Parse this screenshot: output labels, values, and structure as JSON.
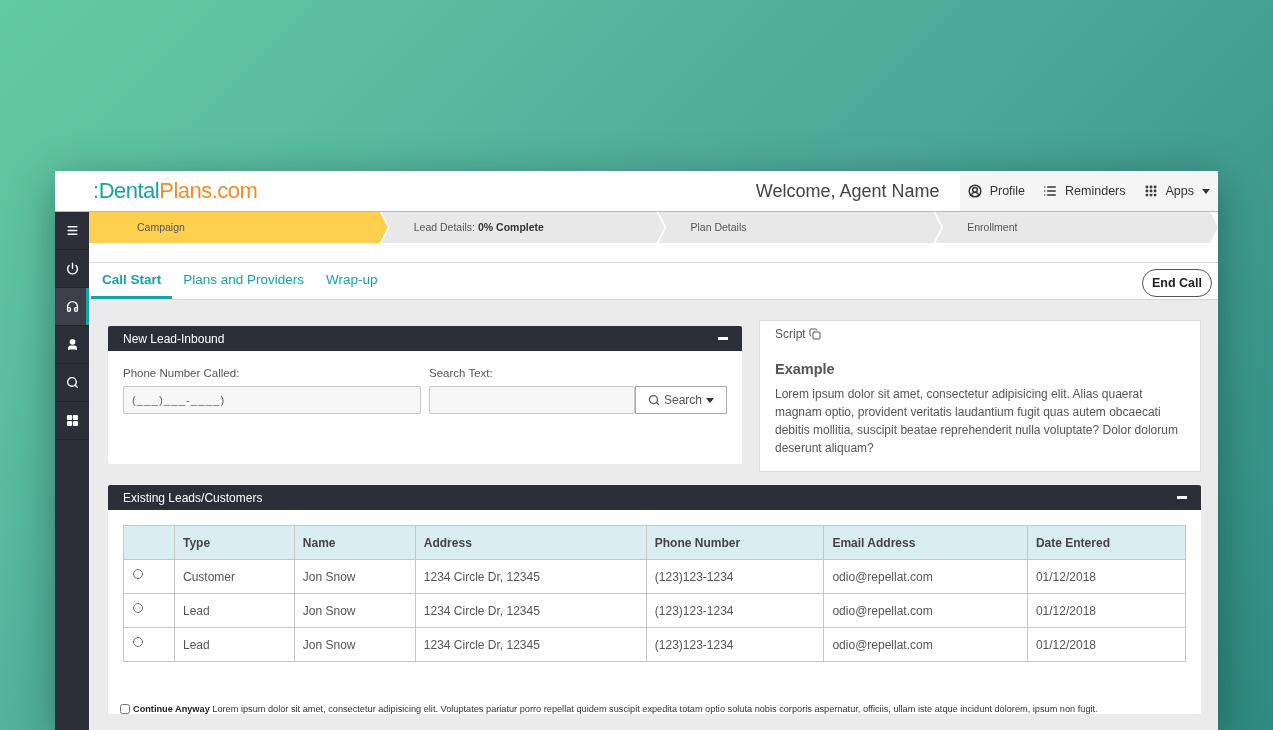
{
  "header": {
    "logo_mark": ":",
    "logo_dental": "Dental",
    "logo_plans": "Plans.com",
    "welcome": "Welcome, Agent Name",
    "nav": [
      {
        "label": "Profile",
        "caret": false
      },
      {
        "label": "Reminders",
        "caret": false
      },
      {
        "label": "Apps",
        "caret": true
      }
    ]
  },
  "sidebar": {
    "items": [
      {
        "selected": false
      },
      {
        "selected": false
      },
      {
        "selected": true
      },
      {
        "selected": false
      },
      {
        "selected": false
      },
      {
        "selected": false
      }
    ]
  },
  "steps": [
    {
      "label": "Campaign",
      "selected": true
    },
    {
      "label": "Lead Details: **0% Complete**",
      "selected": false
    },
    {
      "label": "Plan Details",
      "selected": false
    },
    {
      "label": "Enrollment",
      "selected": false
    }
  ],
  "tabs": [
    {
      "label": "Call Start",
      "selected": true
    },
    {
      "label": "Plans and Providers",
      "selected": false
    },
    {
      "label": "Wrap-up",
      "selected": false
    }
  ],
  "end_call": "End Call",
  "new_lead": {
    "title": "New Lead-Inbound",
    "phone_label": "Phone Number Called:",
    "phone_placeholder": "(___)___-____)",
    "search_label": "Search Text:",
    "search_button": "Search"
  },
  "script": {
    "label": "Script",
    "heading": "Example",
    "body": "Lorem ipsum dolor sit amet, consectetur adipisicing elit. Alias quaerat magnam optio, provident veritatis laudantium fugit quas autem obcaecati debitis mollitia, suscipit beatae reprehenderit nulla voluptate? Dolor dolorum deserunt aliquam?"
  },
  "existing": {
    "title": "Existing Leads/Customers",
    "columns": [
      "Type",
      "Name",
      "Address",
      "Phone Number",
      "Email Address",
      "Date Entered"
    ],
    "rows": [
      {
        "selected": false,
        "cells": [
          "Customer",
          "Jon Snow",
          "1234 Circle Dr, 12345",
          "(123)123-1234",
          "odio@repellat.com",
          "01/12/2018"
        ]
      },
      {
        "selected": false,
        "cells": [
          "Lead",
          "Jon Snow",
          "1234 Circle Dr, 12345",
          "(123)123-1234",
          "odio@repellat.com",
          "01/12/2018"
        ]
      },
      {
        "selected": false,
        "cells": [
          "Lead",
          "Jon Snow",
          "1234 Circle Dr, 12345",
          "(123)123-1234",
          "odio@repellat.com",
          "01/12/2018"
        ]
      }
    ]
  },
  "continue": {
    "checked": false,
    "text": "**Continue Anyway** Lorem ipsum dolor sit amet, consectetur adipisicing elit. Voluptates pariatur porro repellat quidem suscipit expedita totam optio soluta nobis corporis aspernatur, officiis, ullam iste atque incidunt dolorem, ipsum non fugit."
  }
}
